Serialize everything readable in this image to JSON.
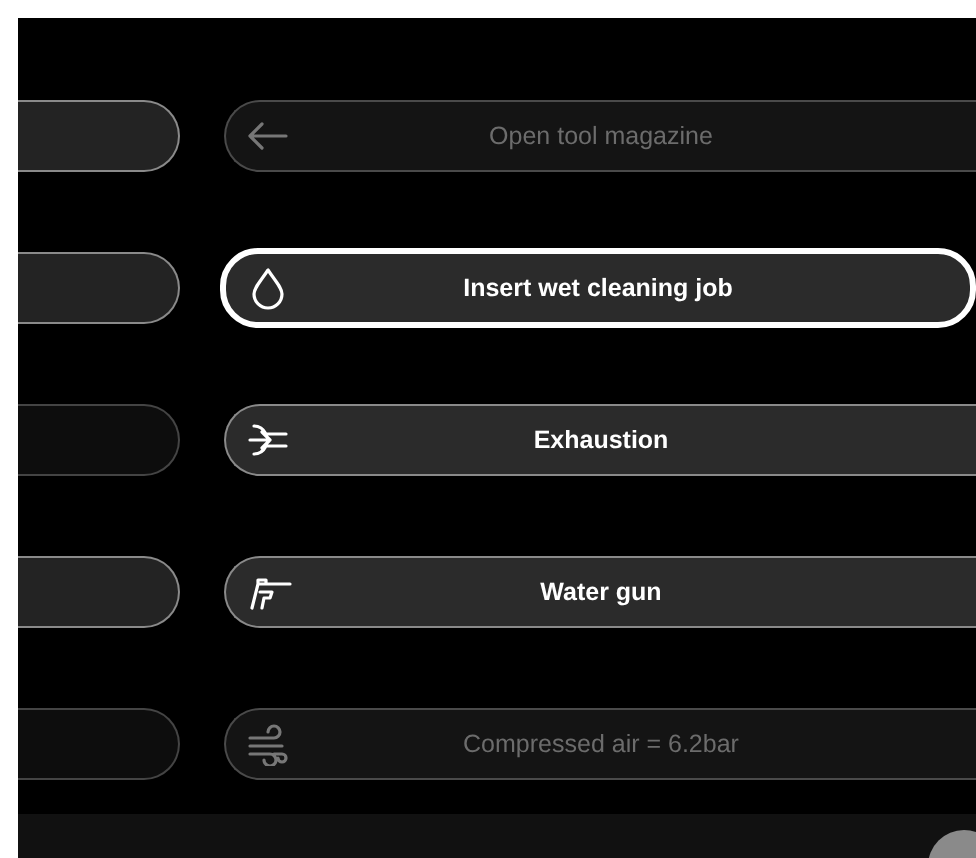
{
  "rows": [
    {
      "kind": "arrow",
      "label": "Open tool magazine",
      "enabled": false,
      "selected": false,
      "side_enabled": true
    },
    {
      "kind": "drop",
      "label": "Insert wet cleaning job",
      "enabled": true,
      "selected": true,
      "side_enabled": true
    },
    {
      "kind": "exhaust",
      "label": "Exhaustion",
      "enabled": true,
      "selected": false,
      "side_enabled": false
    },
    {
      "kind": "gun",
      "label": "Water gun",
      "enabled": true,
      "selected": false,
      "side_enabled": true
    },
    {
      "kind": "wind",
      "label": "Compressed air = 6.2bar",
      "enabled": false,
      "selected": false,
      "side_enabled": false
    }
  ]
}
